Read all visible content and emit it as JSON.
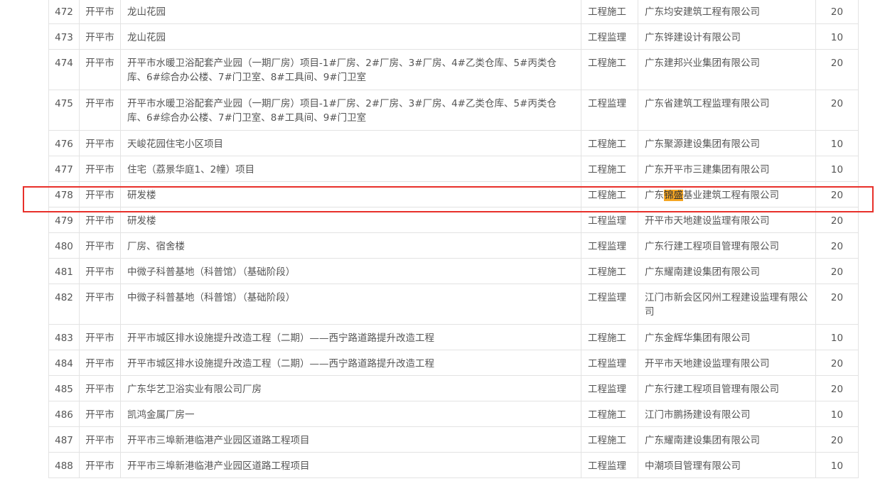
{
  "rows": [
    {
      "no": "472",
      "city": "开平市",
      "project": "龙山花园",
      "type": "工程施工",
      "company": "广东均安建筑工程有限公司",
      "score": "20"
    },
    {
      "no": "473",
      "city": "开平市",
      "project": "龙山花园",
      "type": "工程监理",
      "company": "广东铧建设计有限公司",
      "score": "10"
    },
    {
      "no": "474",
      "city": "开平市",
      "project": "开平市水暖卫浴配套产业园（一期厂房）项目-1#厂房、2#厂房、3#厂房、4#乙类仓库、5#丙类仓库、6#综合办公楼、7#门卫室、8#工具间、9#门卫室",
      "type": "工程施工",
      "company": "广东建邦兴业集团有限公司",
      "score": "20"
    },
    {
      "no": "475",
      "city": "开平市",
      "project": "开平市水暖卫浴配套产业园（一期厂房）项目-1#厂房、2#厂房、3#厂房、4#乙类仓库、5#丙类仓库、6#综合办公楼、7#门卫室、8#工具间、9#门卫室",
      "type": "工程监理",
      "company": "广东省建筑工程监理有限公司",
      "score": "20"
    },
    {
      "no": "476",
      "city": "开平市",
      "project": "天峻花园住宅小区项目",
      "type": "工程施工",
      "company": "广东聚源建设集团有限公司",
      "score": "10"
    },
    {
      "no": "477",
      "city": "开平市",
      "project": "住宅（荔景华庭1、2幢）项目",
      "type": "工程施工",
      "company": "广东开平市三建集团有限公司",
      "score": "10"
    },
    {
      "no": "478",
      "city": "开平市",
      "project": "研发楼",
      "type": "工程施工",
      "company_pre": "广东",
      "company_hl": "锦盛",
      "company_post": "基业建筑工程有限公司",
      "score": "20"
    },
    {
      "no": "479",
      "city": "开平市",
      "project": "研发楼",
      "type": "工程监理",
      "company": "开平市天地建设监理有限公司",
      "score": "20"
    },
    {
      "no": "480",
      "city": "开平市",
      "project": "厂房、宿舍楼",
      "type": "工程监理",
      "company": "广东行建工程项目管理有限公司",
      "score": "20"
    },
    {
      "no": "481",
      "city": "开平市",
      "project": "中微子科普基地（科普馆）（基础阶段）",
      "type": "工程施工",
      "company": "广东耀南建设集团有限公司",
      "score": "20"
    },
    {
      "no": "482",
      "city": "开平市",
      "project": "中微子科普基地（科普馆）（基础阶段）",
      "type": "工程监理",
      "company": "江门市新会区冈州工程建设监理有限公司",
      "score": "20"
    },
    {
      "no": "483",
      "city": "开平市",
      "project": "开平市城区排水设施提升改造工程（二期）——西宁路道路提升改造工程",
      "type": "工程施工",
      "company": "广东金辉华集团有限公司",
      "score": "10"
    },
    {
      "no": "484",
      "city": "开平市",
      "project": "开平市城区排水设施提升改造工程（二期）——西宁路道路提升改造工程",
      "type": "工程监理",
      "company": "开平市天地建设监理有限公司",
      "score": "20"
    },
    {
      "no": "485",
      "city": "开平市",
      "project": "广东华艺卫浴实业有限公司厂房",
      "type": "工程监理",
      "company": "广东行建工程项目管理有限公司",
      "score": "20"
    },
    {
      "no": "486",
      "city": "开平市",
      "project": "凯鸿金属厂房一",
      "type": "工程施工",
      "company": "江门市鹏扬建设有限公司",
      "score": "10"
    },
    {
      "no": "487",
      "city": "开平市",
      "project": "开平市三埠新港临港产业园区道路工程项目",
      "type": "工程施工",
      "company": "广东耀南建设集团有限公司",
      "score": "20"
    },
    {
      "no": "488",
      "city": "开平市",
      "project": "开平市三埠新港临港产业园区道路工程项目",
      "type": "工程监理",
      "company": "中潮项目管理有限公司",
      "score": "10"
    }
  ]
}
